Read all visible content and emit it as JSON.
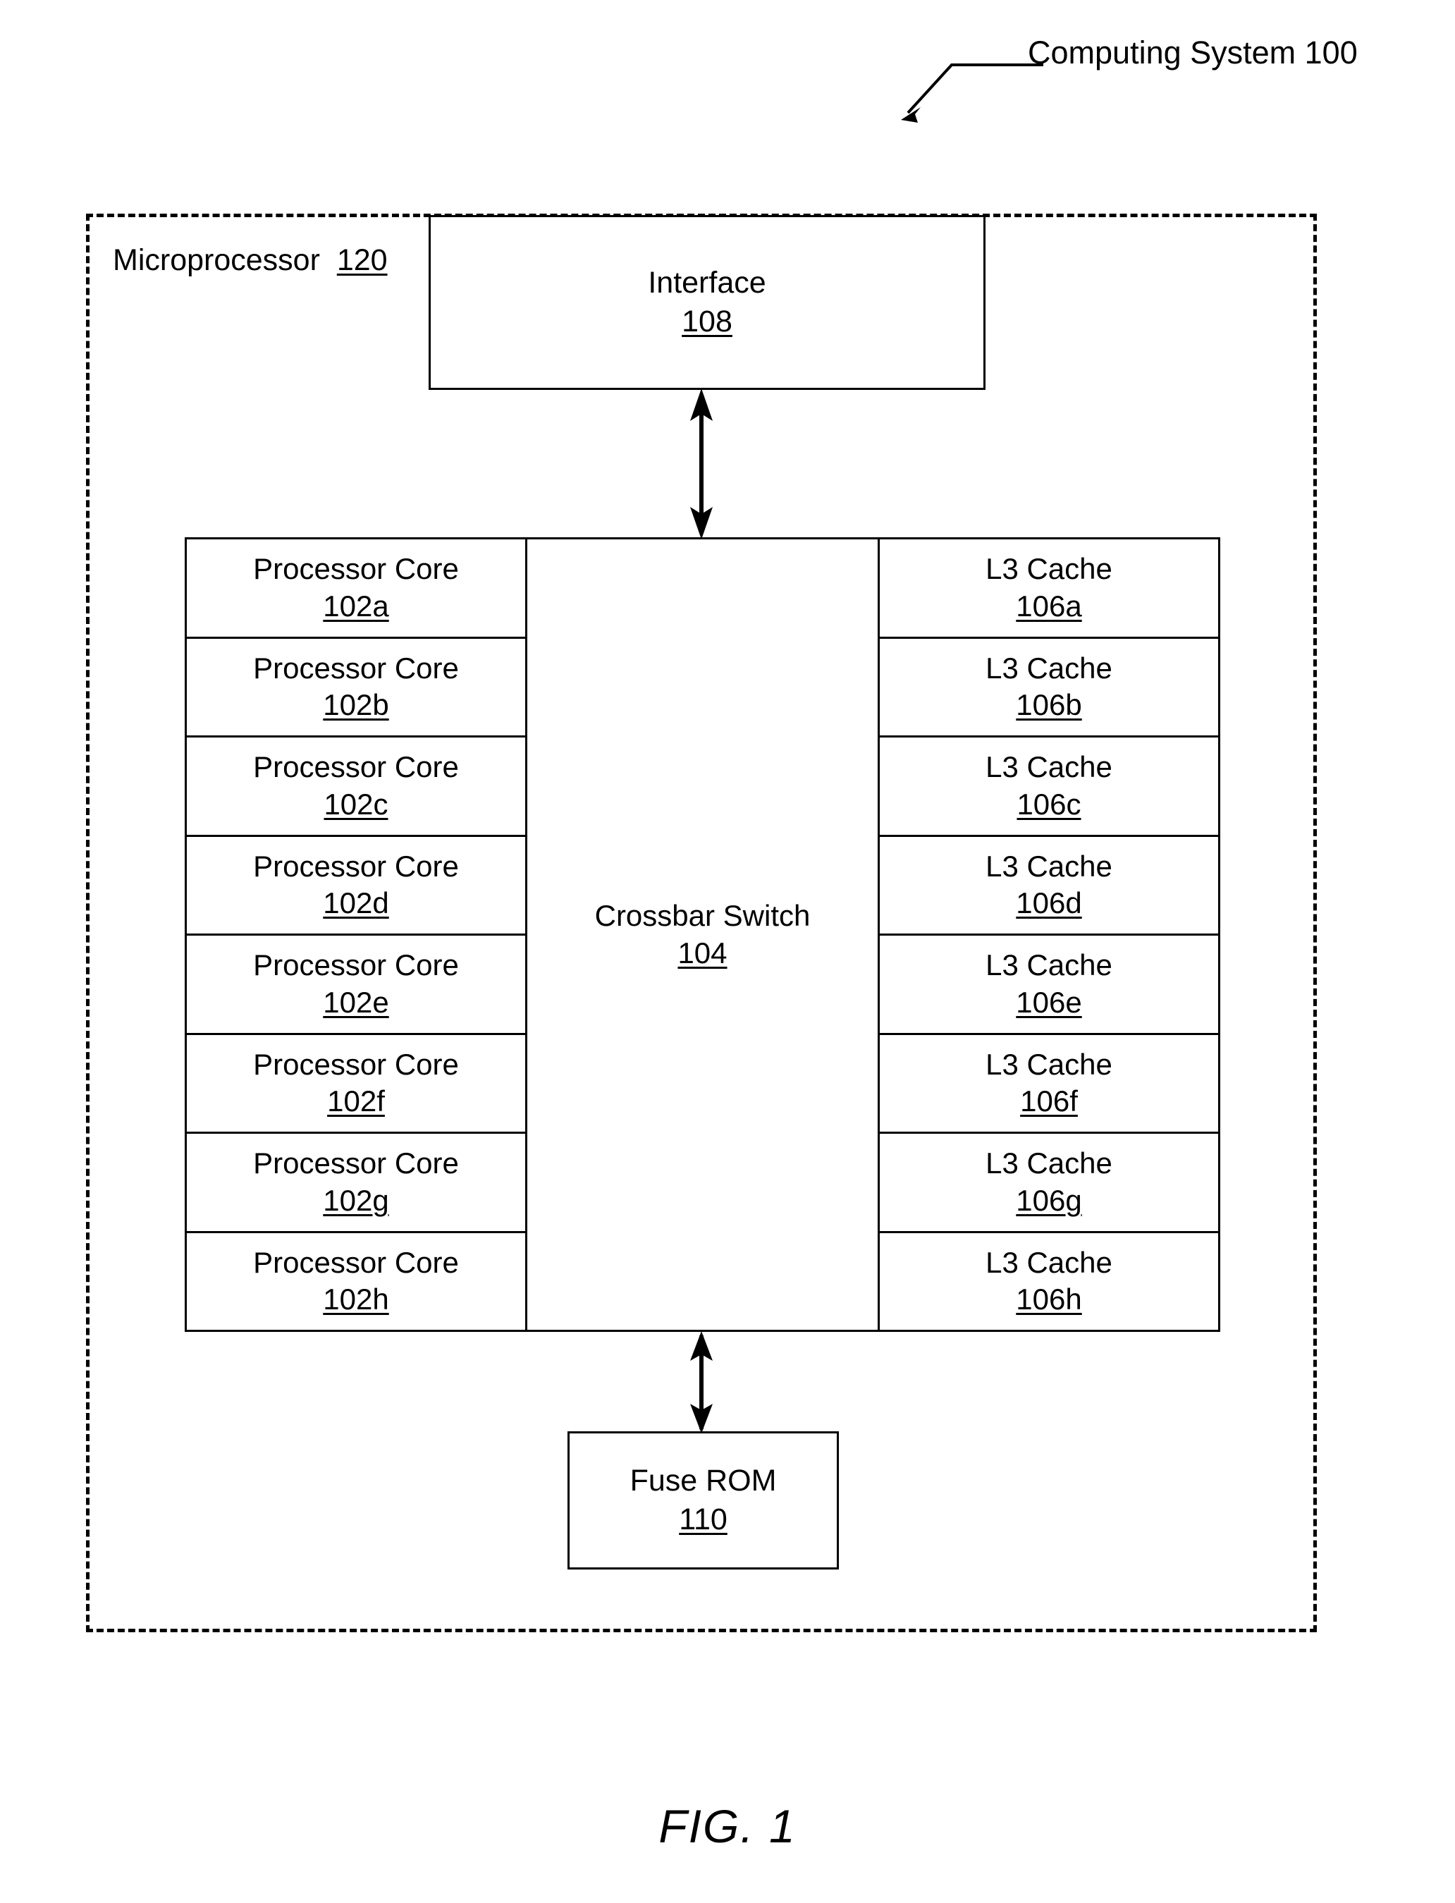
{
  "figure": {
    "caption": "FIG. 1",
    "system_callout": "Computing System 100",
    "enclosure_label_text": "Microprocessor",
    "enclosure_label_ref": "120"
  },
  "blocks": {
    "interface": {
      "title": "Interface",
      "ref": "108"
    },
    "crossbar": {
      "title": "Crossbar Switch",
      "ref": "104"
    },
    "fuse_rom": {
      "title": "Fuse ROM",
      "ref": "110"
    }
  },
  "processor_cores": [
    {
      "title": "Processor Core",
      "ref": "102a"
    },
    {
      "title": "Processor Core",
      "ref": "102b"
    },
    {
      "title": "Processor Core",
      "ref": "102c"
    },
    {
      "title": "Processor Core",
      "ref": "102d"
    },
    {
      "title": "Processor Core",
      "ref": "102e"
    },
    {
      "title": "Processor Core",
      "ref": "102f"
    },
    {
      "title": "Processor Core",
      "ref": "102g"
    },
    {
      "title": "Processor Core",
      "ref": "102h"
    }
  ],
  "l3_caches": [
    {
      "title": "L3 Cache",
      "ref": "106a"
    },
    {
      "title": "L3 Cache",
      "ref": "106b"
    },
    {
      "title": "L3 Cache",
      "ref": "106c"
    },
    {
      "title": "L3 Cache",
      "ref": "106d"
    },
    {
      "title": "L3 Cache",
      "ref": "106e"
    },
    {
      "title": "L3 Cache",
      "ref": "106f"
    },
    {
      "title": "L3 Cache",
      "ref": "106g"
    },
    {
      "title": "L3 Cache",
      "ref": "106h"
    }
  ],
  "connectors": [
    {
      "name": "interface-to-crossbar",
      "style": "double-headed-arrow"
    },
    {
      "name": "crossbar-to-fuse-rom",
      "style": "double-headed-arrow"
    }
  ],
  "colors": {
    "ink": "#000000",
    "paper": "#ffffff"
  }
}
